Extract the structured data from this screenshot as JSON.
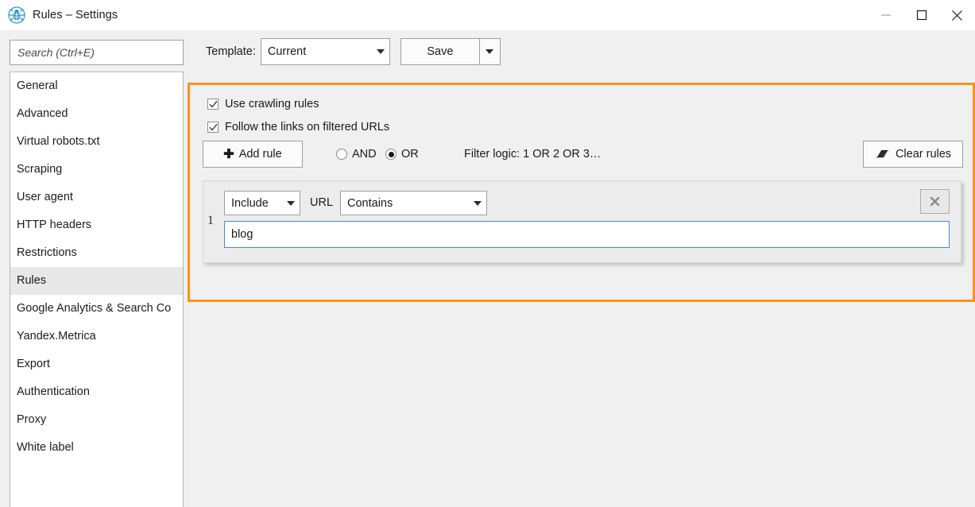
{
  "window": {
    "title": "Rules – Settings",
    "icon": "spider-icon",
    "controls": {
      "minimize": "minimize-icon",
      "maximize": "maximize-icon",
      "close": "close-icon"
    }
  },
  "sidebar": {
    "search": {
      "placeholder": "Search (Ctrl+E)",
      "value": ""
    },
    "items": [
      {
        "label": "General",
        "selected": false
      },
      {
        "label": "Advanced",
        "selected": false
      },
      {
        "label": "Virtual robots.txt",
        "selected": false
      },
      {
        "label": "Scraping",
        "selected": false
      },
      {
        "label": "User agent",
        "selected": false
      },
      {
        "label": "HTTP headers",
        "selected": false
      },
      {
        "label": "Restrictions",
        "selected": false
      },
      {
        "label": "Rules",
        "selected": true
      },
      {
        "label": "Google Analytics & Search Co",
        "selected": false
      },
      {
        "label": "Yandex.Metrica",
        "selected": false
      },
      {
        "label": "Export",
        "selected": false
      },
      {
        "label": "Authentication",
        "selected": false
      },
      {
        "label": "Proxy",
        "selected": false
      },
      {
        "label": "White label",
        "selected": false
      }
    ]
  },
  "toolbar": {
    "template_label": "Template:",
    "template_value": "Current",
    "save_label": "Save"
  },
  "rules_panel": {
    "highlight_color": "#f7941d",
    "use_crawling_rules": {
      "label": "Use crawling rules",
      "checked": true
    },
    "follow_links": {
      "label": "Follow the links on filtered URLs",
      "checked": true
    },
    "add_rule_label": "Add rule",
    "clear_rules_label": "Clear rules",
    "logic_and": {
      "label": "AND",
      "selected": false
    },
    "logic_or": {
      "label": "OR",
      "selected": true
    },
    "filter_logic_text": "Filter logic: 1 OR 2 OR 3…",
    "rules": [
      {
        "index": "1",
        "action": "Include",
        "field_label": "URL",
        "operator": "Contains",
        "value": "blog",
        "focused": true
      }
    ]
  }
}
